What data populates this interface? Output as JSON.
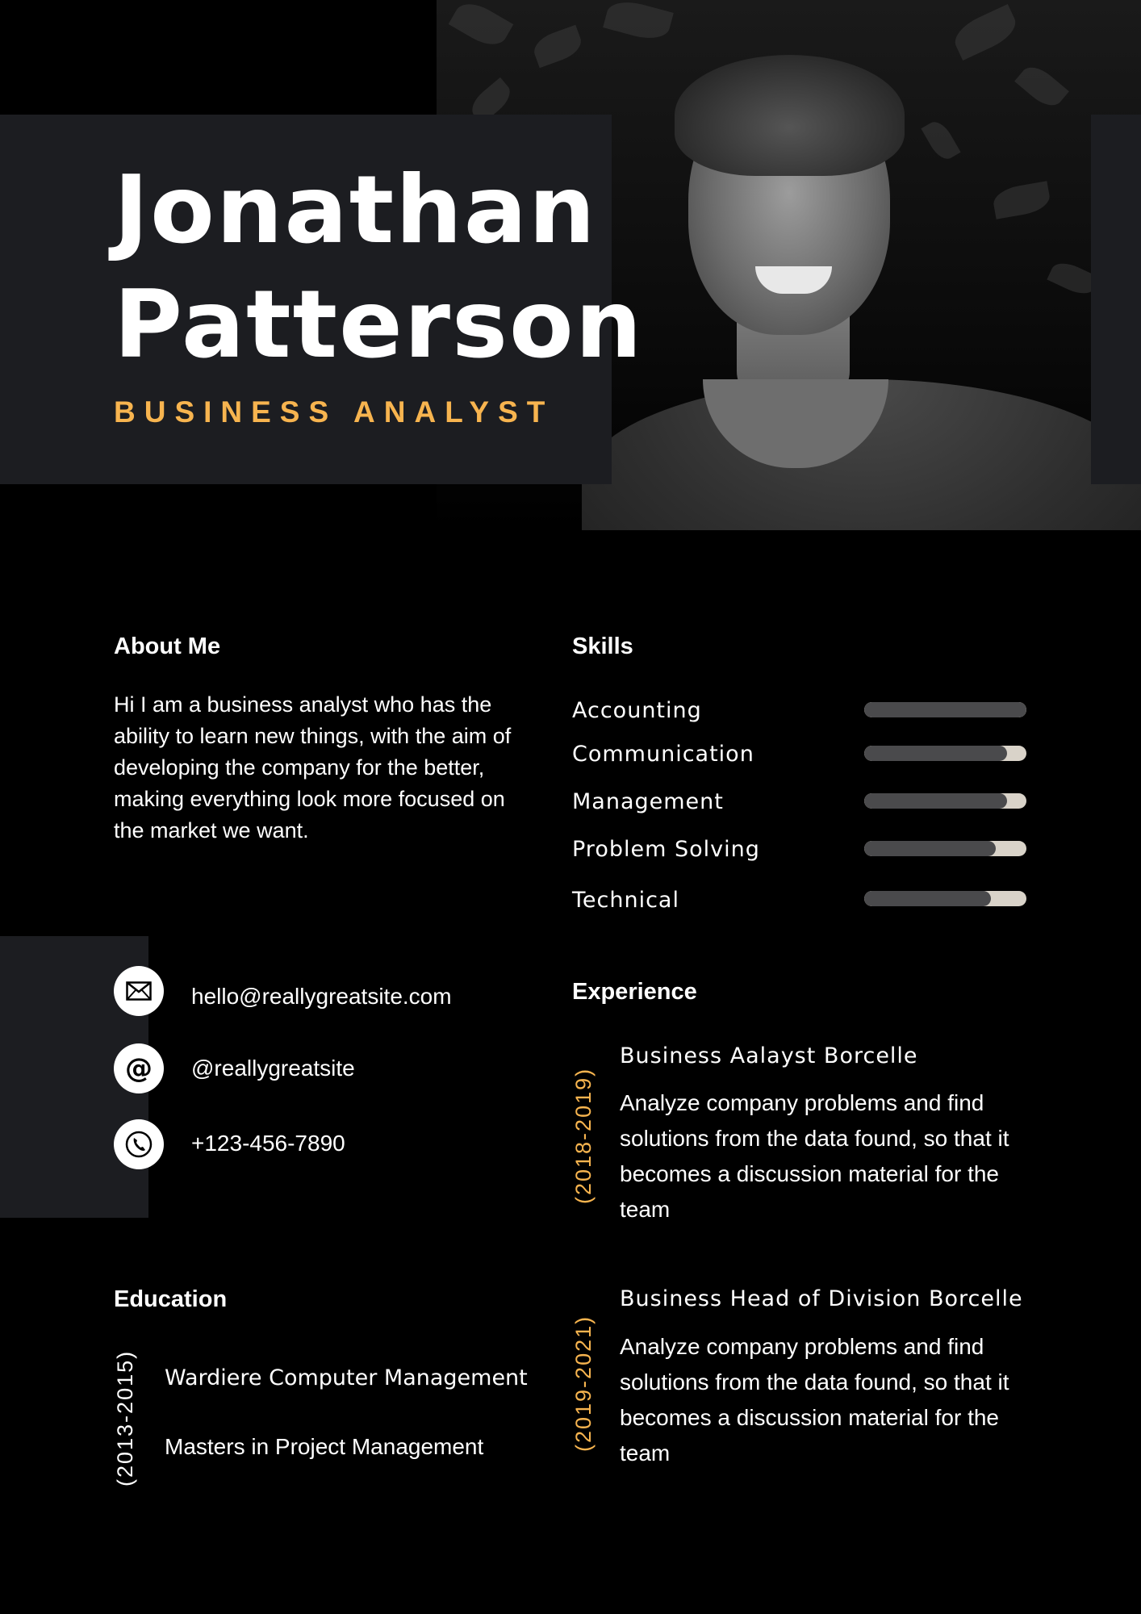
{
  "header": {
    "first_name": "Jonathan",
    "last_name": "Patterson",
    "job_title": "BUSINESS ANALYST"
  },
  "about": {
    "heading": "About Me",
    "text": "Hi I am a business analyst who has the ability to learn new things, with the aim of developing the company for the better, making everything look more focused on the market we want."
  },
  "skills": {
    "heading": "Skills",
    "items": [
      {
        "label": "Accounting",
        "level": 1.0
      },
      {
        "label": "Communication",
        "level": 0.88
      },
      {
        "label": "Management",
        "level": 0.88
      },
      {
        "label": "Problem Solving",
        "level": 0.81
      },
      {
        "label": "Technical",
        "level": 0.78
      }
    ]
  },
  "contact": {
    "email": "hello@reallygreatsite.com",
    "social": "@reallygreatsite",
    "phone": "+123-456-7890",
    "icons": [
      "mail-icon",
      "at-icon",
      "phone-icon"
    ]
  },
  "experience": {
    "heading": "Experience",
    "items": [
      {
        "years": "(2018-2019)",
        "title": "Business Aalayst Borcelle",
        "description": "Analyze company problems and find solutions from the data found, so that it becomes a discussion material for the team"
      },
      {
        "years": "(2019-2021)",
        "title": "Business Head of Division Borcelle",
        "description": "Analyze company problems and find solutions from the data found, so that it becomes a discussion material for the team"
      }
    ]
  },
  "education": {
    "heading": "Education",
    "years": "(2013-2015)",
    "school": "Wardiere Computer Management",
    "degree": "Masters in Project Management"
  },
  "colors": {
    "accent": "#f7b44f",
    "panel": "#1c1d21",
    "background": "#000000",
    "bar_track": "#d9d3c9",
    "bar_fill": "#4a4a4c"
  }
}
